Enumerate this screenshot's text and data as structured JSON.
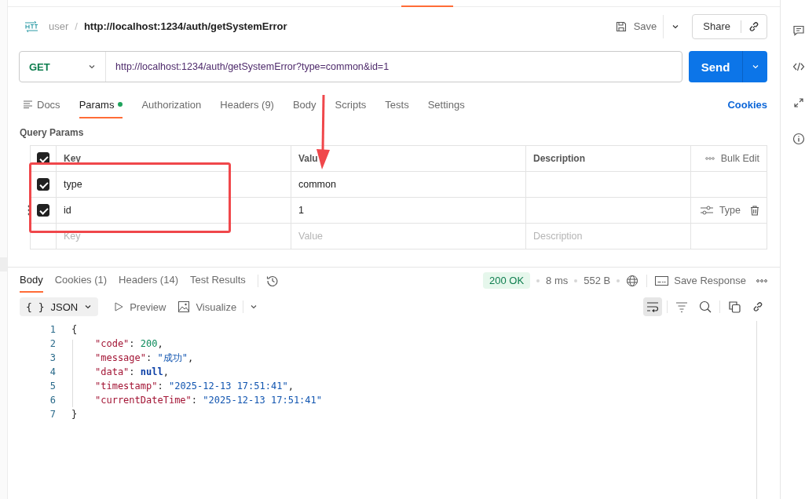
{
  "top_strip": {
    "active_tab_marker": true
  },
  "breadcrumb": {
    "collection": "user",
    "separator": "/",
    "request": "http://localhost:1234/auth/getSystemError"
  },
  "toolbar": {
    "save": "Save",
    "share": "Share"
  },
  "request": {
    "method": "GET",
    "url": "http://localhost:1234/auth/getSystemError?type=common&id=1",
    "send": "Send"
  },
  "request_tabs": [
    {
      "label": "Docs",
      "selected": false,
      "kind": "docs"
    },
    {
      "label": "Params",
      "selected": true,
      "kind": "dot"
    },
    {
      "label": "Authorization",
      "selected": false,
      "kind": "plain"
    },
    {
      "label": "Headers (9)",
      "selected": false,
      "kind": "plain"
    },
    {
      "label": "Body",
      "selected": false,
      "kind": "plain"
    },
    {
      "label": "Scripts",
      "selected": false,
      "kind": "plain"
    },
    {
      "label": "Tests",
      "selected": false,
      "kind": "plain"
    },
    {
      "label": "Settings",
      "selected": false,
      "kind": "plain"
    }
  ],
  "cookies_link": "Cookies",
  "query_params": {
    "title": "Query Params",
    "all_checked": true,
    "columns": [
      "Key",
      "Valu",
      "Description"
    ],
    "bulk_edit": "Bulk Edit",
    "rows": [
      {
        "key": "type",
        "value": "common",
        "checked": true,
        "hovered": false
      },
      {
        "key": "id",
        "value": "1",
        "checked": true,
        "hovered": true,
        "type_label": "Type"
      }
    ],
    "new_row": [
      {
        "placeholder": "Key"
      },
      {
        "placeholder": "Value"
      },
      {
        "placeholder": "Description"
      }
    ]
  },
  "response": {
    "tabs": [
      {
        "label": "Body",
        "selected": true
      },
      {
        "label": "Cookies (1)",
        "selected": false
      },
      {
        "label": "Headers (14)",
        "selected": false
      },
      {
        "label": "Test Results",
        "selected": false
      }
    ],
    "status": "200 OK",
    "time": "8 ms",
    "size": "552 B",
    "save_response": "Save Response",
    "format_icon": "{ }",
    "format": "JSON",
    "views": [
      "Preview",
      "Visualize"
    ],
    "wrap_on": true,
    "lines": [
      {
        "number": "1",
        "tokens": [
          {
            "kind": "punct",
            "text": "{"
          }
        ]
      },
      {
        "number": "2",
        "tokens": [
          {
            "kind": "key",
            "text": "\"code\""
          },
          {
            "kind": "punct",
            "text": ": "
          },
          {
            "kind": "number",
            "text": "200"
          },
          {
            "kind": "punct",
            "text": ","
          }
        ]
      },
      {
        "number": "3",
        "tokens": [
          {
            "kind": "key",
            "text": "\"message\""
          },
          {
            "kind": "punct",
            "text": ": "
          },
          {
            "kind": "string",
            "text": "\"成功\""
          },
          {
            "kind": "punct",
            "text": ","
          }
        ]
      },
      {
        "number": "4",
        "tokens": [
          {
            "kind": "key",
            "text": "\"data\""
          },
          {
            "kind": "punct",
            "text": ": "
          },
          {
            "kind": "null",
            "text": "null"
          },
          {
            "kind": "punct",
            "text": ","
          }
        ]
      },
      {
        "number": "5",
        "tokens": [
          {
            "kind": "key",
            "text": "\"timestamp\""
          },
          {
            "kind": "punct",
            "text": ": "
          },
          {
            "kind": "string",
            "text": "\"2025-12-13 17:51:41\""
          },
          {
            "kind": "punct",
            "text": ","
          }
        ]
      },
      {
        "number": "6",
        "tokens": [
          {
            "kind": "key",
            "text": "\"currentDateTime\""
          },
          {
            "kind": "punct",
            "text": ": "
          },
          {
            "kind": "string",
            "text": "\"2025-12-13 17:51:41\""
          }
        ]
      },
      {
        "number": "7",
        "tokens": [
          {
            "kind": "punct",
            "text": "}"
          }
        ]
      }
    ]
  },
  "annotations": {
    "highlight_box": true,
    "arrow": true
  }
}
